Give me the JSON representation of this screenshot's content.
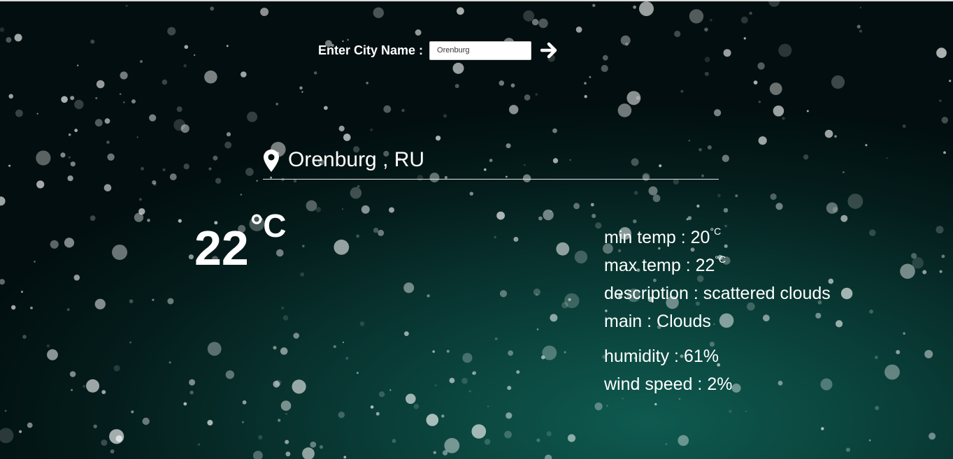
{
  "colors": {
    "background_dark": "#020e0f",
    "background_teal": "#0f5a50",
    "text": "#ffffff"
  },
  "search": {
    "label": "Enter City Name :",
    "input_value": "Orenburg",
    "submit_icon": "arrow-right-icon"
  },
  "location": {
    "icon": "map-marker-icon",
    "text": "Orenburg , RU"
  },
  "current": {
    "temperature": "22",
    "unit": "°C"
  },
  "details": {
    "min_temp_label": "min temp :",
    "min_temp_value": "20",
    "min_temp_unit": "°C",
    "max_temp_label": "max temp :",
    "max_temp_value": "22",
    "max_temp_unit": "°C",
    "description_label": "description :",
    "description_value": "scattered clouds",
    "main_label": "main :",
    "main_value": "Clouds",
    "humidity_label": "humidity :",
    "humidity_value": "61%",
    "wind_label": "wind speed :",
    "wind_value": "2%"
  }
}
